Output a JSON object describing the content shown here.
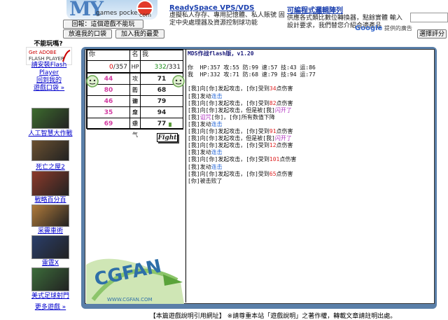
{
  "header": {
    "logo_text": "MY",
    "logo_small": "games pocket",
    "logo_com": "com",
    "report_button": "回報：這個遊戲不能玩",
    "add_pocket_button": "放進我的口袋",
    "add_favorite_button": "加入我的最愛",
    "rate_button": "選擇評分"
  },
  "ads": [
    {
      "title": "ReadySpace VPS/VDS",
      "text1": "虛擬私人存存、專用記憶體、私人賬號 固",
      "text2": "定中央處理器及資源控制球功能"
    },
    {
      "title": "可編程式邏輯陣列",
      "text1": "供應各式類比數位轉換器，點餘實體 輸入",
      "text2": "設計要求，我們替您介紹合適產品"
    }
  ],
  "google": {
    "brand": "Google",
    "caption": "提供的廣告"
  },
  "sidebar": {
    "cant_play": "不能玩嗎?",
    "install_flash": "請安裝Flash Player",
    "flash_get": "Get ADOBE",
    "flash_name": "FLASH PLAYER",
    "back_pocket": "回到我的",
    "back_pocket2": "遊戲口袋 »",
    "games": [
      {
        "label": "人工智慧大作戰",
        "color": "#3d6b2e"
      },
      {
        "label": "死亡之屋2",
        "color": "#6a5030"
      },
      {
        "label": "戰略百分百",
        "color": "#8c3a2a"
      },
      {
        "label": "采霽車術",
        "color": "#b07a3a"
      },
      {
        "label": "雷霆X",
        "color": "#2a3e6a"
      },
      {
        "label": "美式足球射門",
        "color": "#3c6c3a"
      }
    ],
    "more_games": "更多遊戲 »"
  },
  "game": {
    "you_label": "你",
    "name_label": "名",
    "me_label": "我",
    "you_hp": "0",
    "you_hp_max": "/357",
    "hp_label": "HP",
    "me_hp": "332",
    "me_hp_max": "/331",
    "stats": [
      {
        "you": "44",
        "label": "攻击",
        "me": "71",
        "color": "#d23aa0"
      },
      {
        "you": "80",
        "label": "防御",
        "me": "68",
        "color": "#d23aa0"
      },
      {
        "you": "46",
        "label": "速度",
        "me": "79",
        "color": "#d23aa0"
      },
      {
        "you": "35",
        "label": "命中",
        "me": "94",
        "color": "#d23aa0"
      },
      {
        "you": "69",
        "label": "运气",
        "me": "77",
        "color": "#d23aa0"
      }
    ],
    "fight_button": "Fight",
    "brand": "CGFAN",
    "brand_url": "WWW.CGFAN.COM",
    "log_title": "MDS作战flash版，v1.20",
    "log_you": "你  HP:357 攻:55 防:99 速:57 技:43 运:86",
    "log_me": "我  HP:332 攻:71 防:68 速:79 技:94 运:77",
    "log_lines": [
      [
        {
          "t": "[我]向[你]发起攻击，[你]受到"
        },
        {
          "t": "34",
          "c": "#d22"
        },
        {
          "t": "点伤害"
        }
      ],
      [
        {
          "t": "[我]发动"
        },
        {
          "t": "连击",
          "c": "#2a6ad8"
        }
      ],
      [
        {
          "t": "[我]向[你]发起攻击，[你]受到"
        },
        {
          "t": "82",
          "c": "#d22"
        },
        {
          "t": "点伤害"
        }
      ],
      [
        {
          "t": "[我]向[你]发起攻击，但是被[我]"
        },
        {
          "t": "闪开了",
          "c": "#b030c0"
        }
      ],
      [
        {
          "t": "[我]"
        },
        {
          "t": "诅咒",
          "c": "#b030c0"
        },
        {
          "t": "[你]，[你]所有数值下降"
        }
      ],
      [
        {
          "t": "[我]发动"
        },
        {
          "t": "连击",
          "c": "#2a6ad8"
        }
      ],
      [
        {
          "t": "[我]向[你]发起攻击，[你]受到"
        },
        {
          "t": "91",
          "c": "#d22"
        },
        {
          "t": "点伤害"
        }
      ],
      [
        {
          "t": "[我]向[你]发起攻击，但是被[我]"
        },
        {
          "t": "闪开了",
          "c": "#b030c0"
        }
      ],
      [
        {
          "t": "[我]向[你]发起攻击，[你]受到"
        },
        {
          "t": "12",
          "c": "#d22"
        },
        {
          "t": "点伤害"
        }
      ],
      [
        {
          "t": "[我]发动"
        },
        {
          "t": "连击",
          "c": "#2a6ad8"
        }
      ],
      [
        {
          "t": "[我]向[你]发起攻击，[你]受到"
        },
        {
          "t": "101",
          "c": "#d22"
        },
        {
          "t": "点伤害"
        }
      ],
      [
        {
          "t": "[我]发动"
        },
        {
          "t": "连击",
          "c": "#2a6ad8"
        }
      ],
      [
        {
          "t": "[我]向[你]发起攻击，[你]受到"
        },
        {
          "t": "65",
          "c": "#d22"
        },
        {
          "t": "点伤害"
        }
      ],
      [
        {
          "t": "[你]被击败了"
        }
      ]
    ]
  },
  "footer": "【本篇遊戲說明引用網址】 ※請尊重本站「遊戲說明」之著作權，轉載文章請註明出處。"
}
